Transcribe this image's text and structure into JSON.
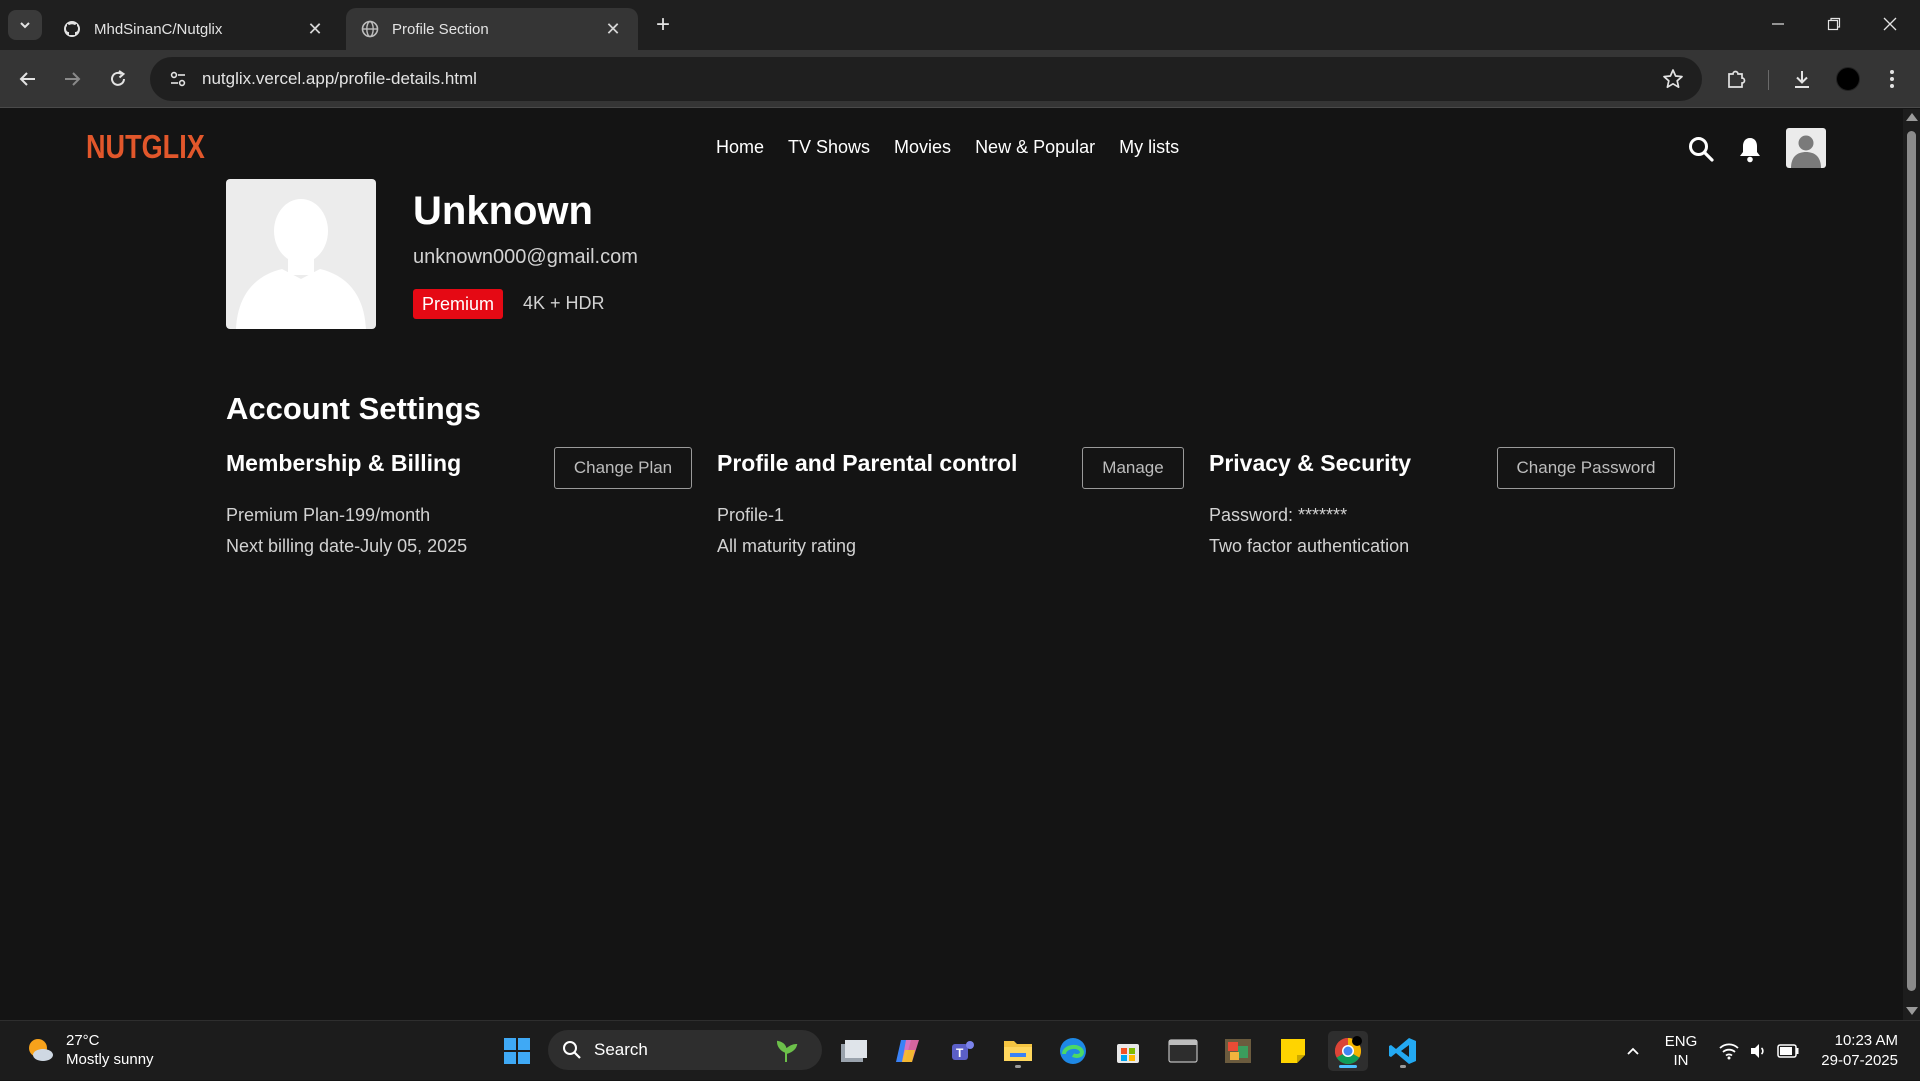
{
  "browser": {
    "tabs": [
      {
        "title": "MhdSinanC/Nutglix",
        "icon": "github-icon"
      },
      {
        "title": "Profile Section",
        "icon": "globe-icon",
        "active": true
      }
    ],
    "url": "nutglix.vercel.app/profile-details.html"
  },
  "site": {
    "logo": "NUTGLIX",
    "nav": [
      "Home",
      "TV Shows",
      "Movies",
      "New & Popular",
      "My lists"
    ]
  },
  "profile": {
    "name": "Unknown",
    "email": "unknown000@gmail.com",
    "plan_badge": "Premium",
    "quality": "4K + HDR"
  },
  "account": {
    "title": "Account Settings",
    "sections": [
      {
        "title": "Membership & Billing",
        "button": "Change Plan",
        "lines": [
          "Premium Plan-199/month",
          "Next billing date-July 05, 2025"
        ]
      },
      {
        "title": "Profile and Parental control",
        "button": "Manage",
        "lines": [
          "Profile-1",
          "All maturity rating"
        ]
      },
      {
        "title": "Privacy & Security",
        "button": "Change Password",
        "lines": [
          "Password: *******",
          "Two factor authentication"
        ]
      }
    ]
  },
  "taskbar": {
    "weather_temp": "27°C",
    "weather_desc": "Mostly sunny",
    "search_label": "Search",
    "lang_line1": "ENG",
    "lang_line2": "IN",
    "time": "10:23 AM",
    "date": "29-07-2025"
  },
  "colors": {
    "accent_red": "#e50914",
    "logo_orange": "#e2572b",
    "page_bg": "#141414"
  }
}
